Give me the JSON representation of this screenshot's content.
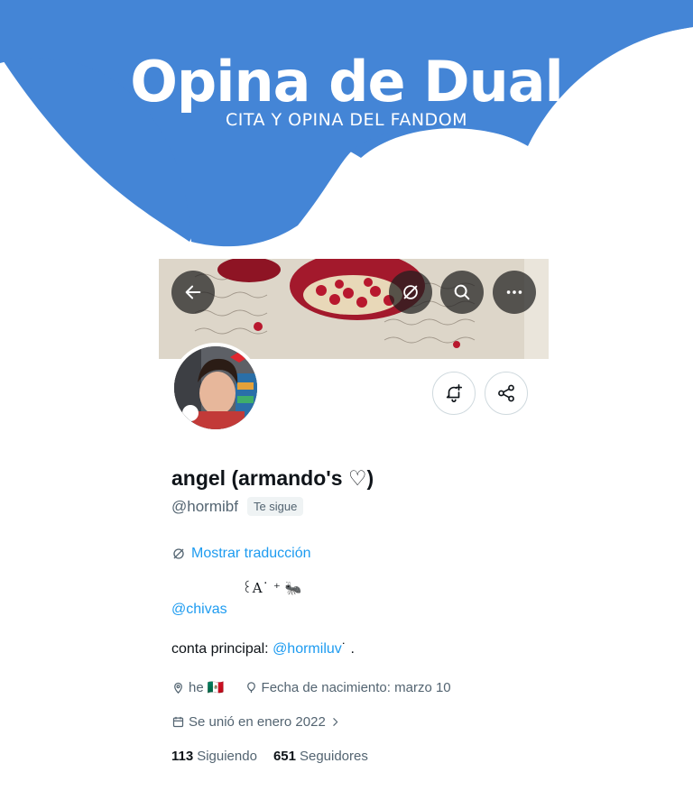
{
  "brand": {
    "title": "Opina  de Dual",
    "subtitle": "CITA Y OPINA DEL FANDOM",
    "color": "#4485d6"
  },
  "toolbar": {
    "back_icon": "arrow-left-icon",
    "translate_icon": "no-translate-icon",
    "search_icon": "search-icon",
    "more_icon": "more-horizontal-icon"
  },
  "profile": {
    "display_name": "angel (armando's ♡)",
    "handle": "@hormibf",
    "follows_you_badge": "Te sigue",
    "notify_icon": "bell-plus-icon",
    "share_icon": "share-icon"
  },
  "bio": {
    "translate_label": "Mostrar traducción",
    "symbols": "꒰A˙ ⁺ 🐜",
    "mention": "@chivas",
    "line_prefix": "conta principal: ",
    "line_link": "@hormiluv",
    "line_suffix": "˙ ."
  },
  "meta": {
    "location": "he 🇲🇽",
    "birthday": "Fecha de nacimiento: marzo 10",
    "joined": "Se unió en enero 2022"
  },
  "stats": {
    "following_count": "113",
    "following_label": "Siguiendo",
    "followers_count": "651",
    "followers_label": "Seguidores"
  },
  "colors": {
    "link": "#1d9bf0",
    "muted": "#536471",
    "text": "#0f1419"
  }
}
